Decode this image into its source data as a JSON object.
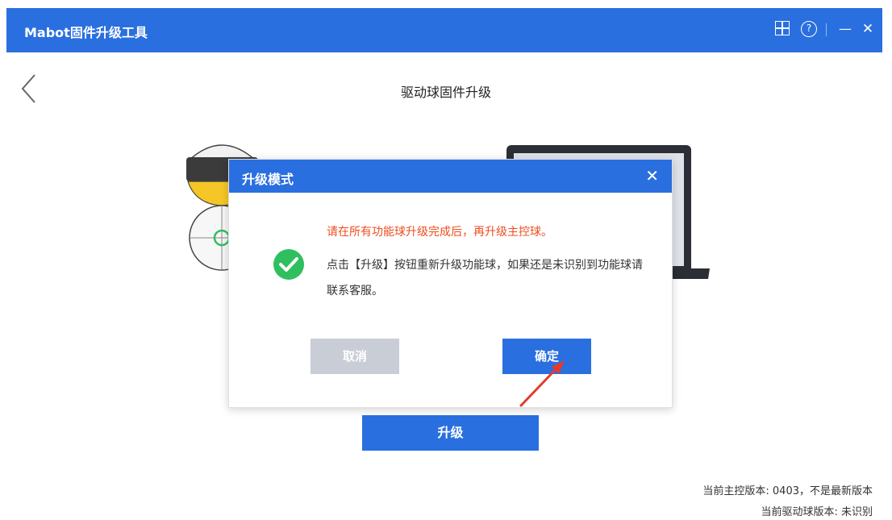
{
  "window": {
    "title": "Mabot固件升级工具",
    "icons": [
      "grid-icon",
      "help-icon",
      "minimize-icon",
      "close-icon"
    ]
  },
  "page": {
    "title": "驱动球固件升级",
    "upgrade_label": "升级",
    "main_version": "当前主控版本: 0403，不是最新版本",
    "drive_version": "当前驱动球版本: 未识别"
  },
  "dialog": {
    "title": "升级模式",
    "warning": "请在所有功能球升级完成后，再升级主控球。",
    "message": "点击【升级】按钮重新升级功能球，如果还是未识别到功能球请联系客服。",
    "cancel_label": "取消",
    "ok_label": "确定"
  },
  "colors": {
    "primary": "#2a6fdf",
    "warning": "#ee4e1f",
    "success": "#2fbf5f",
    "disabled": "#c8cdd6"
  }
}
